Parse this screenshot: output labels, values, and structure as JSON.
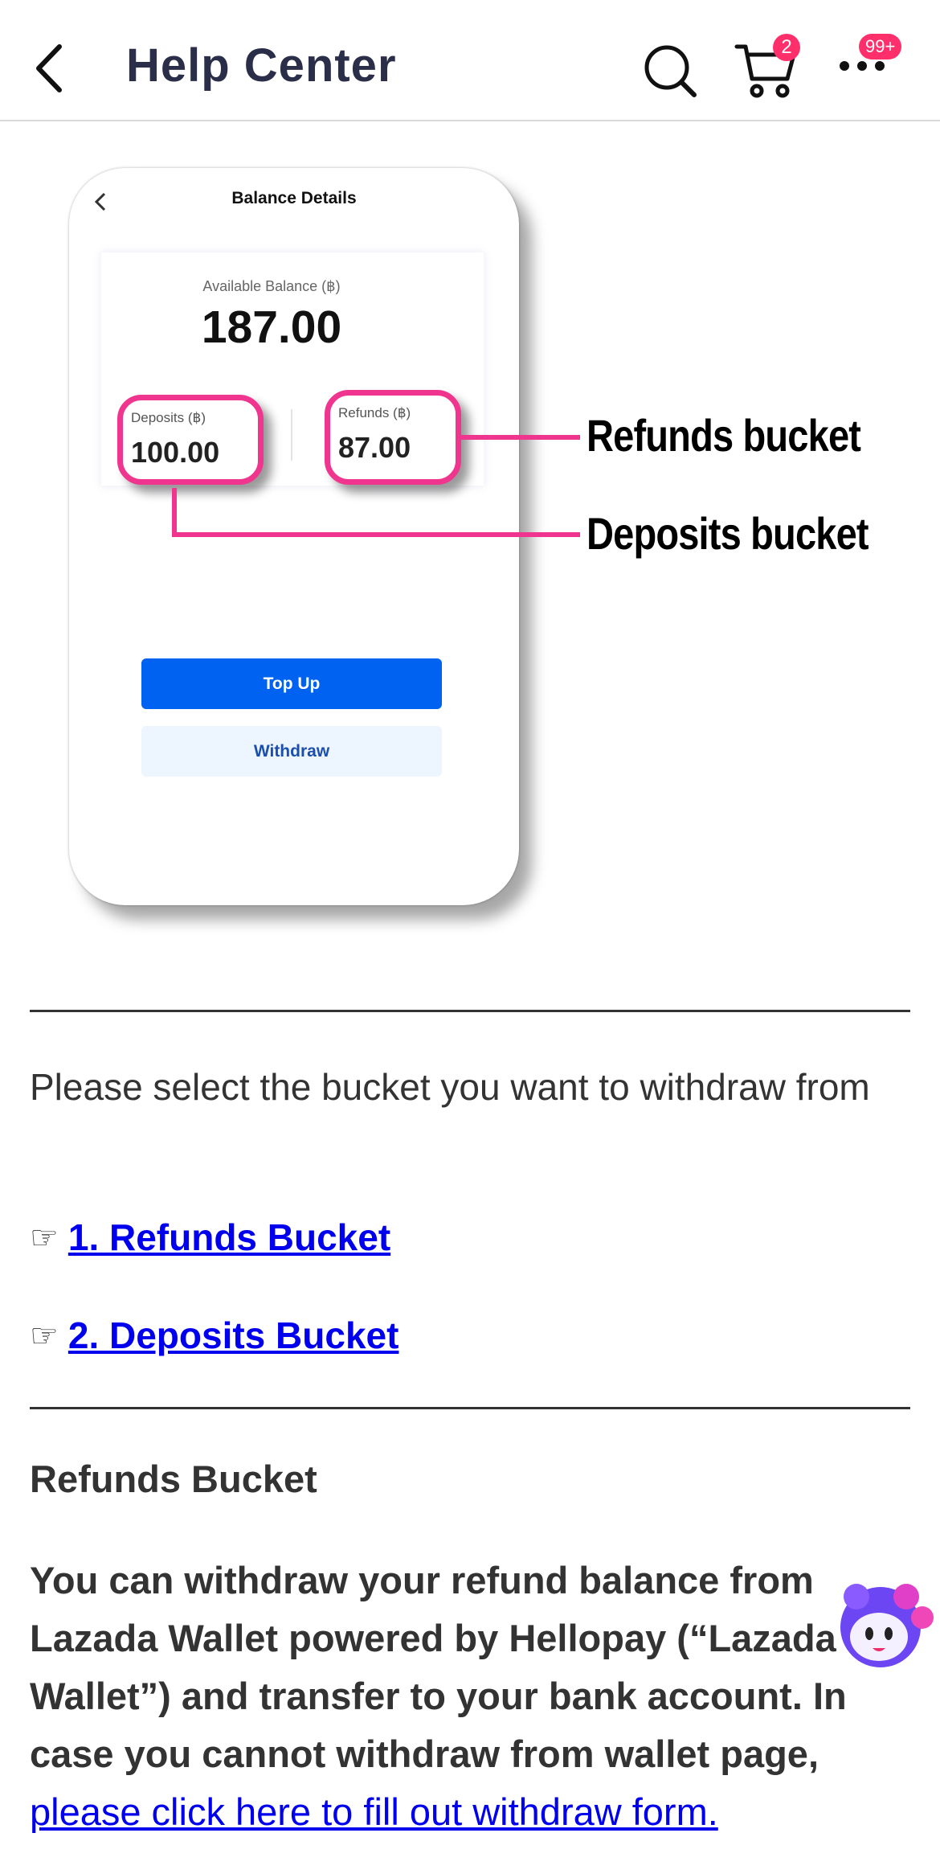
{
  "header": {
    "title": "Help Center",
    "cart_count": "2",
    "notification_count": "99+",
    "icons": [
      "back-arrow-icon",
      "search-icon",
      "cart-icon",
      "more-icon"
    ]
  },
  "illustration": {
    "phone": {
      "title": "Balance Details",
      "available_label": "Available Balance (฿)",
      "available_amount": "187.00",
      "deposits_label": "Deposits (฿)",
      "deposits_amount": "100.00",
      "refunds_label": "Refunds (฿)",
      "refunds_amount": "87.00",
      "topup_label": "Top Up",
      "withdraw_label": "Withdraw"
    },
    "callouts": {
      "refunds": "Refunds bucket",
      "deposits": "Deposits bucket"
    },
    "highlight_color": "#f0358f"
  },
  "article": {
    "intro": "Please select the bucket you want to withdraw from",
    "hand_glyph": "☞",
    "links": [
      {
        "label": "1. Refunds Bucket"
      },
      {
        "label": "2. Deposits Bucket"
      }
    ],
    "section_title": "Refunds Bucket",
    "body": "You can withdraw your refund balance from Lazada Wallet powered by Hellopay (“Lazada Wallet”) and transfer to your bank account. In case you cannot withdraw from wallet page,",
    "body_link": "please click here to fill out withdraw form."
  },
  "colors": {
    "badge": "#fe2f6a",
    "link": "#0000ee",
    "primary_button": "#0062f0"
  }
}
